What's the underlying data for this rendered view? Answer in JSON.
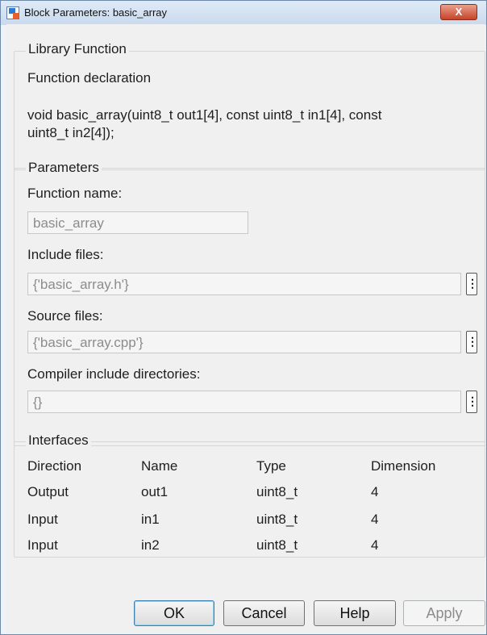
{
  "window": {
    "title": "Block Parameters: basic_array",
    "close_glyph": "X"
  },
  "library_function": {
    "legend": "Library Function",
    "declaration_label": "Function declaration",
    "declaration_line1": "void basic_array(uint8_t out1[4], const uint8_t in1[4], const",
    "declaration_line2": "uint8_t in2[4]);"
  },
  "parameters": {
    "legend": "Parameters",
    "function_name_label": "Function name:",
    "function_name_value": "basic_array",
    "include_files_label": "Include files:",
    "include_files_value": "{'basic_array.h'}",
    "source_files_label": "Source files:",
    "source_files_value": "{'basic_array.cpp'}",
    "compiler_dirs_label": "Compiler include directories:",
    "compiler_dirs_value": "{}",
    "more_glyph": "⋮"
  },
  "interfaces": {
    "legend": "Interfaces",
    "columns": [
      "Direction",
      "Name",
      "Type",
      "Dimension"
    ],
    "rows": [
      [
        "Output",
        "out1",
        "uint8_t",
        "4"
      ],
      [
        "Input",
        "in1",
        "uint8_t",
        "4"
      ],
      [
        "Input",
        "in2",
        "uint8_t",
        "4"
      ]
    ]
  },
  "buttons": {
    "ok": "OK",
    "cancel": "Cancel",
    "help": "Help",
    "apply": "Apply"
  }
}
